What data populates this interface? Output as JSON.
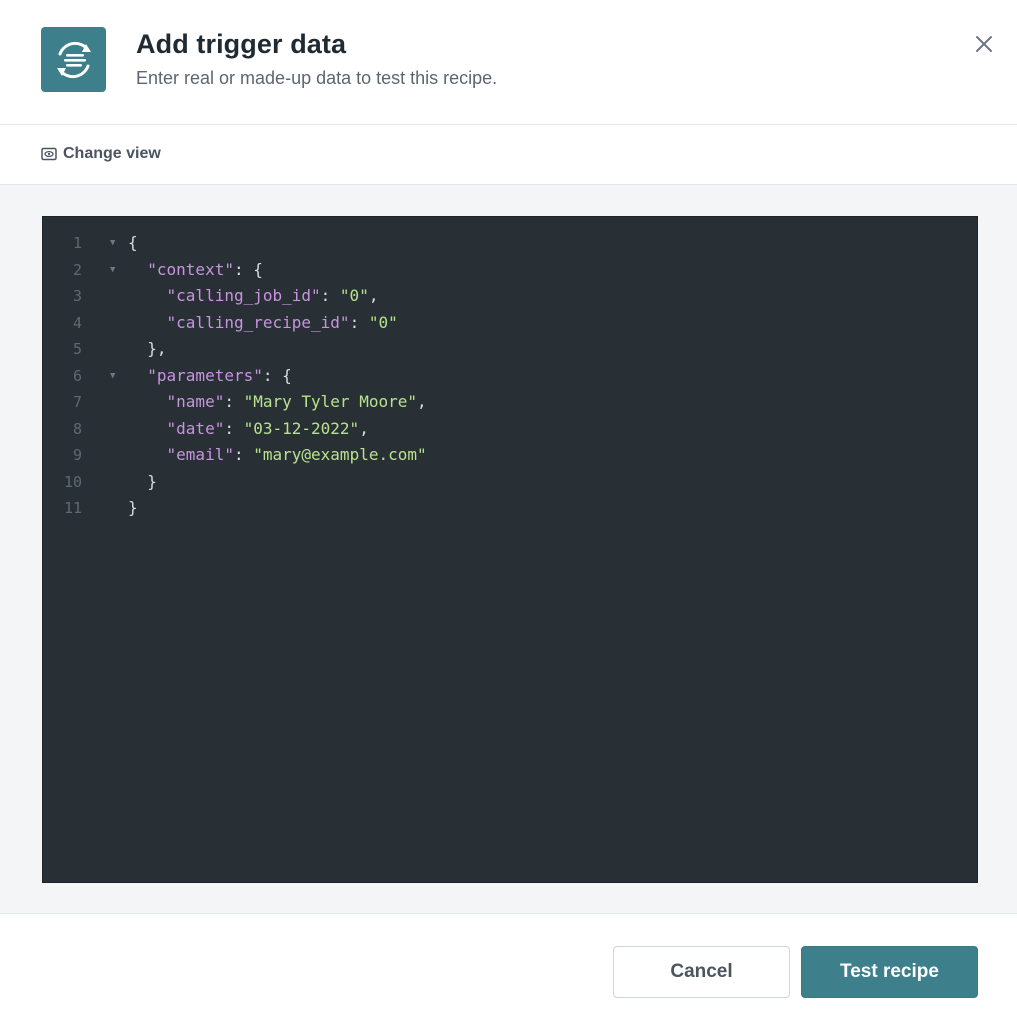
{
  "header": {
    "icon": "sync-data-icon",
    "title": "Add trigger data",
    "subtitle": "Enter real or made-up data to test this recipe.",
    "close_icon": "close-icon"
  },
  "toolbar": {
    "change_view_icon": "eye-icon",
    "change_view_label": "Change view"
  },
  "editor": {
    "line_numbers": [
      "1",
      "2",
      "3",
      "4",
      "5",
      "6",
      "7",
      "8",
      "9",
      "10",
      "11"
    ],
    "lines": [
      {
        "indent": "",
        "parts": [
          [
            "p",
            "{"
          ]
        ],
        "fold": true
      },
      {
        "indent": "  ",
        "parts": [
          [
            "k",
            "\"context\""
          ],
          [
            "p",
            ": {"
          ]
        ],
        "fold": true
      },
      {
        "indent": "    ",
        "parts": [
          [
            "k",
            "\"calling_job_id\""
          ],
          [
            "p",
            ": "
          ],
          [
            "s",
            "\"0\""
          ],
          [
            "p",
            ","
          ]
        ],
        "fold": false
      },
      {
        "indent": "    ",
        "parts": [
          [
            "k",
            "\"calling_recipe_id\""
          ],
          [
            "p",
            ": "
          ],
          [
            "s",
            "\"0\""
          ]
        ],
        "fold": false
      },
      {
        "indent": "  ",
        "parts": [
          [
            "p",
            "},"
          ]
        ],
        "fold": false
      },
      {
        "indent": "  ",
        "parts": [
          [
            "k",
            "\"parameters\""
          ],
          [
            "p",
            ": {"
          ]
        ],
        "fold": true
      },
      {
        "indent": "    ",
        "parts": [
          [
            "k",
            "\"name\""
          ],
          [
            "p",
            ": "
          ],
          [
            "s",
            "\"Mary Tyler Moore\""
          ],
          [
            "p",
            ","
          ]
        ],
        "fold": false
      },
      {
        "indent": "    ",
        "parts": [
          [
            "k",
            "\"date\""
          ],
          [
            "p",
            ": "
          ],
          [
            "s",
            "\"03-12-2022\""
          ],
          [
            "p",
            ","
          ]
        ],
        "fold": false
      },
      {
        "indent": "    ",
        "parts": [
          [
            "k",
            "\"email\""
          ],
          [
            "p",
            ": "
          ],
          [
            "s",
            "\"mary@example.com\""
          ]
        ],
        "fold": false
      },
      {
        "indent": "  ",
        "parts": [
          [
            "p",
            "}"
          ]
        ],
        "fold": false
      },
      {
        "indent": "",
        "parts": [
          [
            "p",
            "}"
          ]
        ],
        "fold": false
      }
    ]
  },
  "footer": {
    "cancel_label": "Cancel",
    "test_label": "Test recipe"
  },
  "colors": {
    "accent": "#3d7f8b",
    "editor_bg": "#283035",
    "json_key": "#c893e0",
    "json_string": "#b9e28c"
  }
}
